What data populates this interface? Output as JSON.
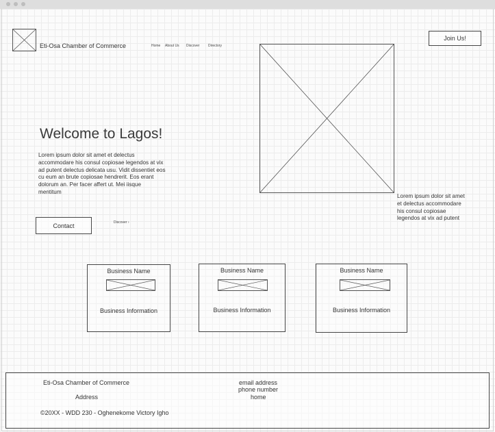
{
  "header": {
    "site_title": "Eti-Osa Chamber of Commerce",
    "join_button": "Join Us!",
    "nav": [
      "Home",
      "About Us",
      "Discover",
      "Directory"
    ]
  },
  "hero": {
    "heading": "Welcome to Lagos!",
    "body_lines": [
      "Lorem ipsum dolor sit amet et delectus",
      "accommodare his consul copiosae legendos at vix",
      "ad putent delectus delicata usu. Vidit dissentiet eos",
      "cu eum an brute copiosae hendrerit. Eos erant",
      "dolorum an. Per facer affert ut. Mei iisque",
      "mentitum"
    ],
    "contact_button": "Contact",
    "discover_link": "Discover",
    "caption_lines": [
      "Lorem ipsum dolor sit amet",
      "et delectus accommodare",
      "his consul copiosae",
      "legendos at vix ad putent"
    ]
  },
  "businesses": [
    {
      "name": "Business Name",
      "info": "Business Information"
    },
    {
      "name": "Business Name",
      "info": "Business Information"
    },
    {
      "name": "Business Name",
      "info": "Business Information"
    }
  ],
  "footer": {
    "org": "Eti-Osa Chamber of Commerce",
    "address": "Address",
    "copyright": "©20XX - WDD 230 - Oghenekome Victory Igho",
    "email": "email address",
    "phone": "phone number",
    "home": "home"
  }
}
